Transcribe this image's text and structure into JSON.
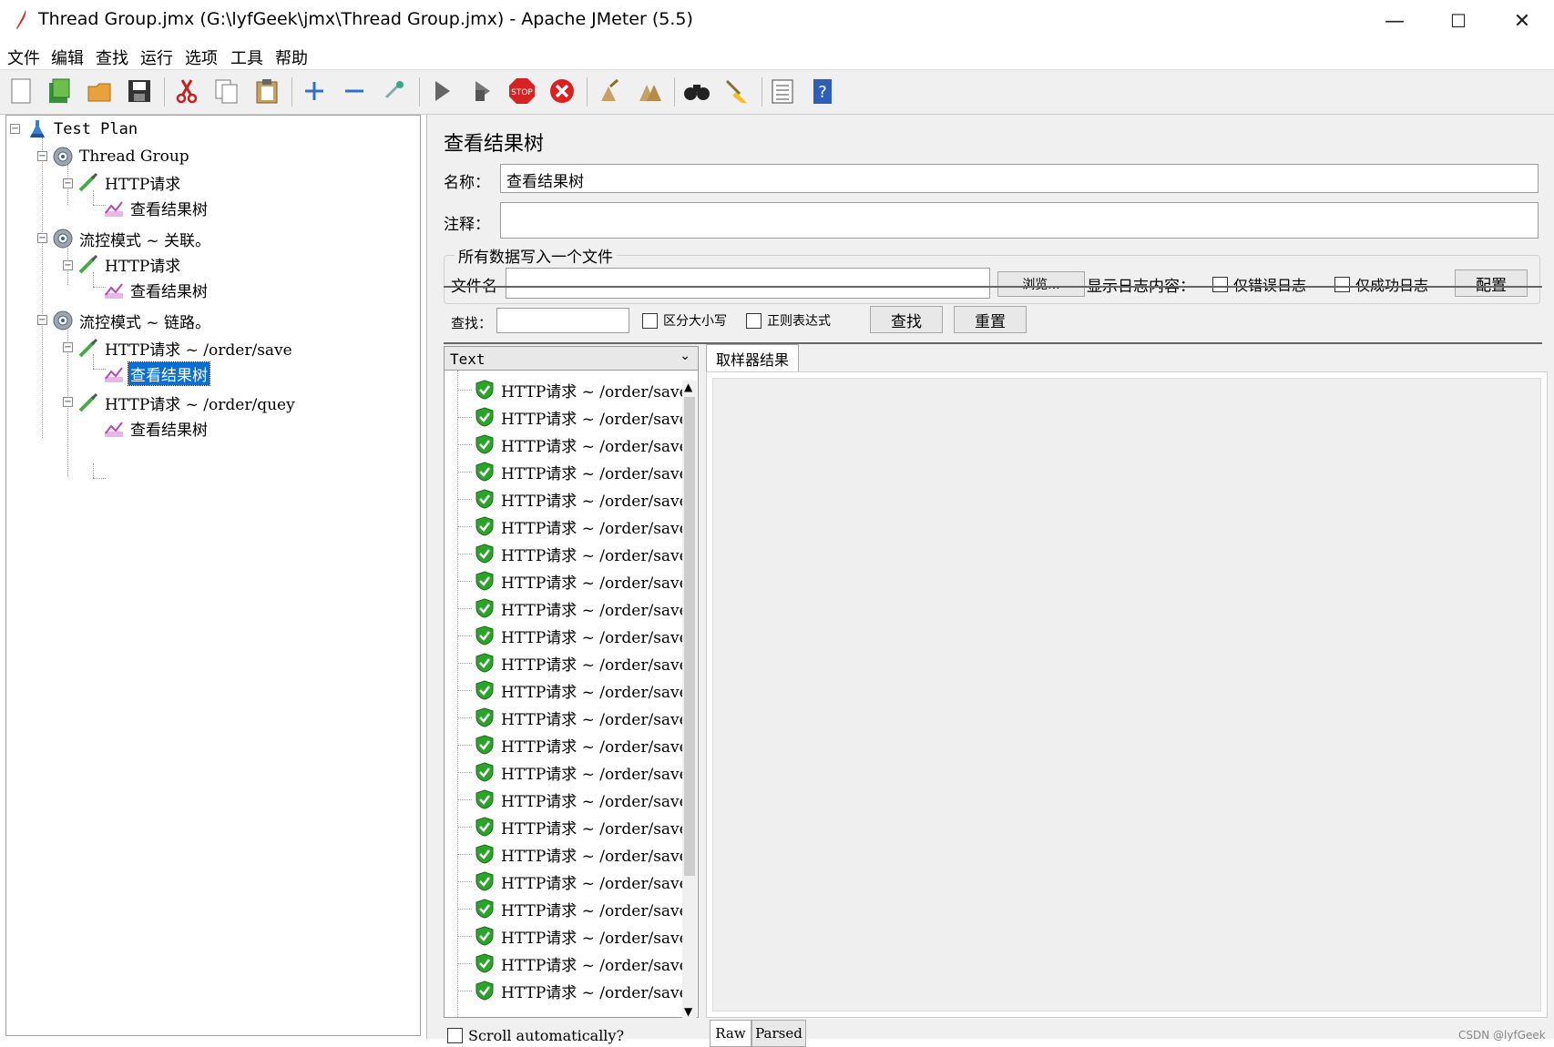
{
  "window": {
    "title": "Thread Group.jmx (G:\\lyfGeek\\jmx\\Thread Group.jmx) - Apache JMeter (5.5)",
    "controls": [
      "—",
      "☐",
      "✕"
    ]
  },
  "menu": [
    "文件",
    "编辑",
    "查找",
    "运行",
    "选项",
    "工具",
    "帮助"
  ],
  "toolbar_icons": [
    "new-icon",
    "templates-icon",
    "open-icon",
    "save-icon",
    "cut-icon",
    "copy-icon",
    "paste-icon",
    "expand-icon",
    "collapse-icon",
    "toggle-icon",
    "start-icon",
    "start-no-pause-icon",
    "stop-icon",
    "shutdown-icon",
    "clear-icon",
    "clear-all-icon",
    "search-icon",
    "reset-search-icon",
    "function-helper-icon",
    "help-icon"
  ],
  "tree": {
    "nodes": [
      {
        "label": "Test Plan",
        "icon": "test-plan-icon"
      },
      {
        "label": "Thread Group",
        "icon": "gear-icon"
      },
      {
        "label": "HTTP请求",
        "icon": "sampler-icon"
      },
      {
        "label": "查看结果树",
        "icon": "listener-icon"
      },
      {
        "label": "流控模式 ~ 关联。",
        "icon": "gear-icon"
      },
      {
        "label": "HTTP请求",
        "icon": "sampler-icon"
      },
      {
        "label": "查看结果树",
        "icon": "listener-icon"
      },
      {
        "label": "流控模式 ~ 链路。",
        "icon": "gear-icon"
      },
      {
        "label": "HTTP请求 ~ /order/save",
        "icon": "sampler-icon"
      },
      {
        "label": "查看结果树",
        "icon": "listener-icon",
        "selected": true
      },
      {
        "label": "HTTP请求 ~ /order/quey",
        "icon": "sampler-icon"
      },
      {
        "label": "查看结果树",
        "icon": "listener-icon"
      }
    ]
  },
  "panel": {
    "heading": "查看结果树",
    "name_label": "名称：",
    "name_value": "查看结果树",
    "comment_label": "注释：",
    "comment_value": "",
    "file_group": "所有数据写入一个文件",
    "filename_label": "文件名",
    "browse": "浏览...",
    "log_label": "显示日志内容：",
    "errors_only": "仅错误日志",
    "success_only": "仅成功日志",
    "configure": "配置",
    "search_label": "查找：",
    "case_sensitive": "区分大小写",
    "regex": "正则表达式",
    "search_btn": "查找",
    "reset_btn": "重置",
    "renderer": "Text",
    "result_tab": "取样器结果",
    "scroll_auto": "Scroll automatically?",
    "raw_tab": "Raw",
    "parsed_tab": "Parsed"
  },
  "results": [
    "HTTP请求 ~ /order/save",
    "HTTP请求 ~ /order/save",
    "HTTP请求 ~ /order/save",
    "HTTP请求 ~ /order/save",
    "HTTP请求 ~ /order/save",
    "HTTP请求 ~ /order/save",
    "HTTP请求 ~ /order/save",
    "HTTP请求 ~ /order/save",
    "HTTP请求 ~ /order/save",
    "HTTP请求 ~ /order/save",
    "HTTP请求 ~ /order/save",
    "HTTP请求 ~ /order/save",
    "HTTP请求 ~ /order/save",
    "HTTP请求 ~ /order/save",
    "HTTP请求 ~ /order/save",
    "HTTP请求 ~ /order/save",
    "HTTP请求 ~ /order/save",
    "HTTP请求 ~ /order/save",
    "HTTP请求 ~ /order/save",
    "HTTP请求 ~ /order/save",
    "HTTP请求 ~ /order/save",
    "HTTP请求 ~ /order/save",
    "HTTP请求 ~ /order/save"
  ],
  "watermark": "CSDN @lyfGeek",
  "colors": {
    "selection": "#0a6fd4",
    "success": "#2aa52a"
  }
}
